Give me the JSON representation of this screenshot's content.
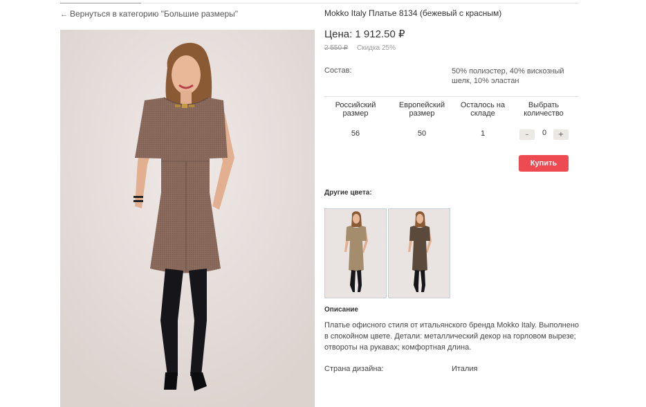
{
  "nav": {
    "back_link": "Вернуться в категорию \"Большие размеры\""
  },
  "product": {
    "title": "Mokko Italy Платье 8134 (бежевый с красным)",
    "price": "Цена: 1 912.50 ₽",
    "old_price": "2 550 ₽",
    "discount": "Скидка 25%"
  },
  "composition": {
    "label": "Состав:",
    "value": "50% полиэстер, 40% вискозный шелк, 10% эластан"
  },
  "size_table": {
    "headers": [
      "Российский размер",
      "Европейский размер",
      "Осталось на складе",
      "Выбрать количество"
    ],
    "rows": [
      {
        "ru_size": "56",
        "eu_size": "50",
        "stock": "1",
        "quantity": "0"
      }
    ],
    "minus_label": "–",
    "plus_label": "+"
  },
  "buy_button": "Купить",
  "other_colors": {
    "heading": "Другие цвета:",
    "items": [
      {
        "name": "beige-dress-thumbnail",
        "color": "#a38d6c"
      },
      {
        "name": "dark-brown-dress-thumbnail",
        "color": "#5b4a3c"
      }
    ]
  },
  "description": {
    "heading": "Описание",
    "text": "Платье офисного стиля от итальянского бренда Mokko Italy. Выполнено в спокойном цвете. Детали: металлический декор на горловом вырезе; отвороты на рукавах; комфортная длина."
  },
  "design_country": {
    "label": "Страна дизайна:",
    "value": "Италия"
  },
  "colors": {
    "accent": "#ee4a52",
    "main_dress": "#8a6b5d",
    "photo_background": "#e6dfdc"
  }
}
